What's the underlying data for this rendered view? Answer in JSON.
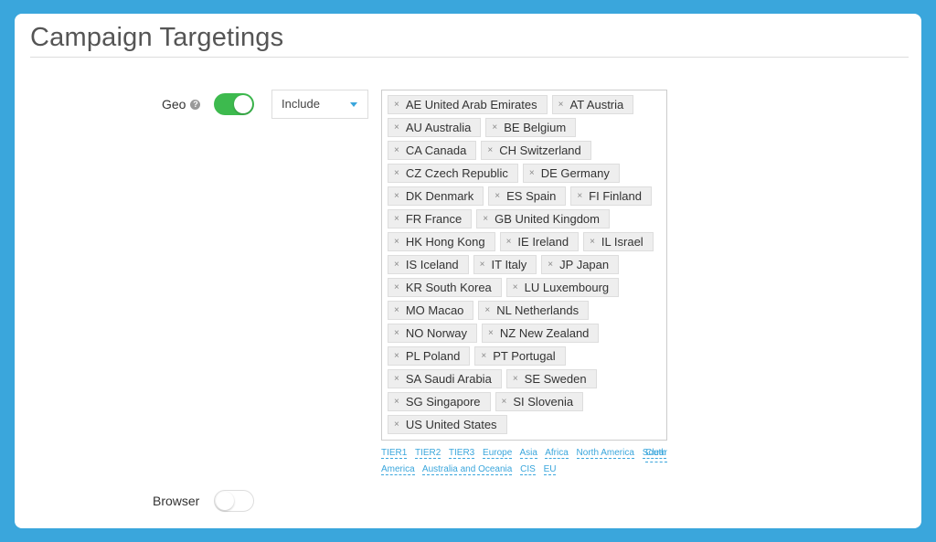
{
  "page": {
    "title": "Campaign Targetings"
  },
  "geo": {
    "label": "Geo",
    "help_icon": "?",
    "enabled": true,
    "mode": "Include",
    "countries": [
      "AE United Arab Emirates",
      "AT Austria",
      "AU Australia",
      "BE Belgium",
      "CA Canada",
      "CH Switzerland",
      "CZ Czech Republic",
      "DE Germany",
      "DK Denmark",
      "ES Spain",
      "FI Finland",
      "FR France",
      "GB United Kingdom",
      "HK Hong Kong",
      "IE Ireland",
      "IL Israel",
      "IS Iceland",
      "IT Italy",
      "JP Japan",
      "KR South Korea",
      "LU Luxembourg",
      "MO Macao",
      "NL Netherlands",
      "NO Norway",
      "NZ New Zealand",
      "PL Poland",
      "PT Portugal",
      "SA Saudi Arabia",
      "SE Sweden",
      "SG Singapore",
      "SI Slovenia",
      "US United States"
    ],
    "remove_glyph": "×",
    "presets": [
      "TIER1",
      "TIER2",
      "TIER3",
      "Europe",
      "Asia",
      "Africa",
      "North America",
      "South America",
      "Australia and Oceania",
      "CIS",
      "EU"
    ],
    "clear_label": "Clear"
  },
  "browser": {
    "label": "Browser",
    "enabled": false
  },
  "colors": {
    "accent": "#3aa6dc",
    "toggle_on": "#3dba4e"
  }
}
